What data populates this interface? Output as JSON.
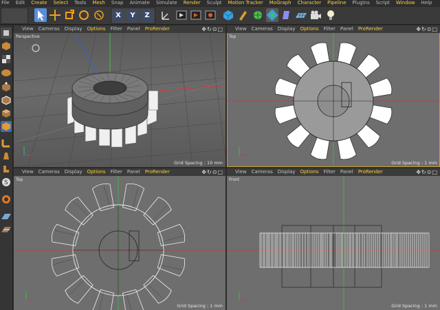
{
  "menu": [
    "File",
    "Edit",
    "Create",
    "Select",
    "Tools",
    "Mesh",
    "Snap",
    "Animate",
    "Simulate",
    "Render",
    "Sculpt",
    "Motion Tracker",
    "MoGraph",
    "Character",
    "Pipeline",
    "Plugins",
    "Script",
    "Window",
    "Help"
  ],
  "menu_highlight": [
    "Create",
    "Select",
    "Mesh",
    "Render",
    "Motion Tracker",
    "MoGraph",
    "Character",
    "Pipeline",
    "Window"
  ],
  "toolbar": {
    "axis_x": "X",
    "axis_y": "Y",
    "axis_z": "Z"
  },
  "viewport_menu": [
    "View",
    "Cameras",
    "Display",
    "Options",
    "Filter",
    "Panel",
    "ProRender"
  ],
  "viewport_menu_highlight": [
    "Options",
    "ProRender"
  ],
  "viewports": {
    "perspective": {
      "label": "Perspective",
      "grid": "Grid Spacing : 10 mm"
    },
    "top_right": {
      "label": "Top",
      "grid": "Grid Spacing : 1 mm"
    },
    "top_bottom": {
      "label": "Top",
      "grid": "Grid Spacing : 1 mm"
    },
    "front": {
      "label": "Front",
      "grid": "Grid Spacing : 1 mm"
    }
  },
  "colors": {
    "accent": "#ffd23f",
    "active_border": "#c9a227",
    "axis_x": "#d33a3a",
    "axis_y": "#3fbf3f",
    "axis_z": "#3a5fd3"
  }
}
